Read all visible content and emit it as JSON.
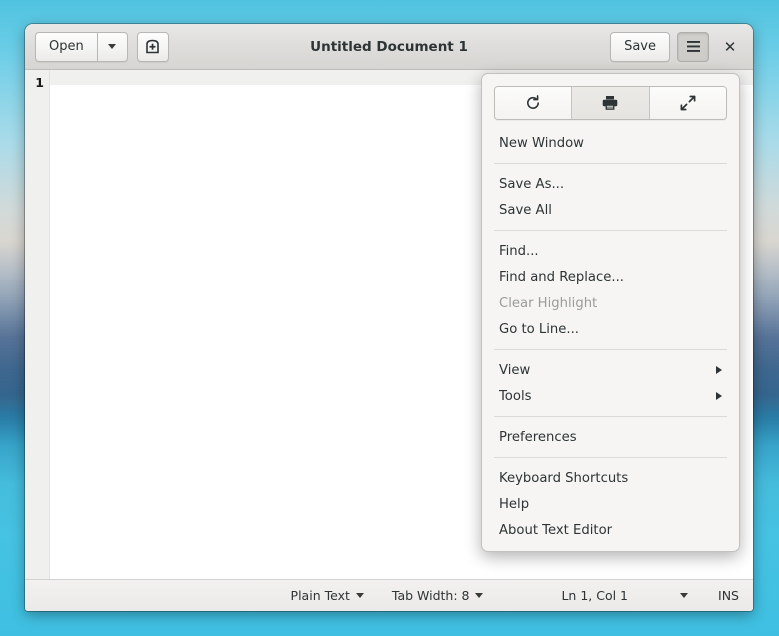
{
  "window": {
    "title": "Untitled Document 1",
    "header": {
      "open_label": "Open",
      "open_dropdown_icon": "chevron-down-icon",
      "new_document_icon": "new-tab-plus-icon",
      "save_label": "Save",
      "menu_icon": "hamburger-menu-icon",
      "close_icon": "close-x-icon",
      "close_glyph": "✕"
    }
  },
  "document": {
    "line_numbers": [
      "1"
    ],
    "content": ""
  },
  "statusbar": {
    "language": "Plain Text",
    "language_dropdown_icon": "chevron-down-icon",
    "tab_width": "Tab Width: 8",
    "tab_width_dropdown_icon": "chevron-down-icon",
    "position": "Ln 1, Col 1",
    "position_dropdown_icon": "chevron-down-icon",
    "insert_mode": "INS"
  },
  "menu": {
    "toolbar": [
      {
        "name": "reload-button",
        "icon": "reload-icon",
        "active": false
      },
      {
        "name": "print-button",
        "icon": "printer-icon",
        "active": true
      },
      {
        "name": "fullscreen-button",
        "icon": "fullscreen-arrows-icon",
        "active": false
      }
    ],
    "groups": [
      {
        "items": [
          {
            "label": "New Window",
            "name": "menu-item-new-window",
            "disabled": false,
            "submenu": false
          }
        ]
      },
      {
        "items": [
          {
            "label": "Save As...",
            "name": "menu-item-save-as",
            "disabled": false,
            "submenu": false
          },
          {
            "label": "Save All",
            "name": "menu-item-save-all",
            "disabled": false,
            "submenu": false
          }
        ]
      },
      {
        "items": [
          {
            "label": "Find...",
            "name": "menu-item-find",
            "disabled": false,
            "submenu": false
          },
          {
            "label": "Find and Replace...",
            "name": "menu-item-find-and-replace",
            "disabled": false,
            "submenu": false
          },
          {
            "label": "Clear Highlight",
            "name": "menu-item-clear-highlight",
            "disabled": true,
            "submenu": false
          },
          {
            "label": "Go to Line...",
            "name": "menu-item-go-to-line",
            "disabled": false,
            "submenu": false
          }
        ]
      },
      {
        "items": [
          {
            "label": "View",
            "name": "menu-item-view",
            "disabled": false,
            "submenu": true
          },
          {
            "label": "Tools",
            "name": "menu-item-tools",
            "disabled": false,
            "submenu": true
          }
        ]
      },
      {
        "items": [
          {
            "label": "Preferences",
            "name": "menu-item-preferences",
            "disabled": false,
            "submenu": false
          }
        ]
      },
      {
        "items": [
          {
            "label": "Keyboard Shortcuts",
            "name": "menu-item-keyboard-shortcuts",
            "disabled": false,
            "submenu": false
          },
          {
            "label": "Help",
            "name": "menu-item-help",
            "disabled": false,
            "submenu": false
          },
          {
            "label": "About Text Editor",
            "name": "menu-item-about-text-editor",
            "disabled": false,
            "submenu": false
          }
        ]
      }
    ]
  },
  "colors": {
    "headerbar": "#dedddb",
    "menu_background": "#f6f5f4",
    "text_primary": "#2e3436",
    "text_disabled": "#9b9b99",
    "gutter": "#f0f0ef",
    "wallpaper_cyan": "#4fc3e0",
    "wallpaper_deep_blue": "#30648f"
  }
}
